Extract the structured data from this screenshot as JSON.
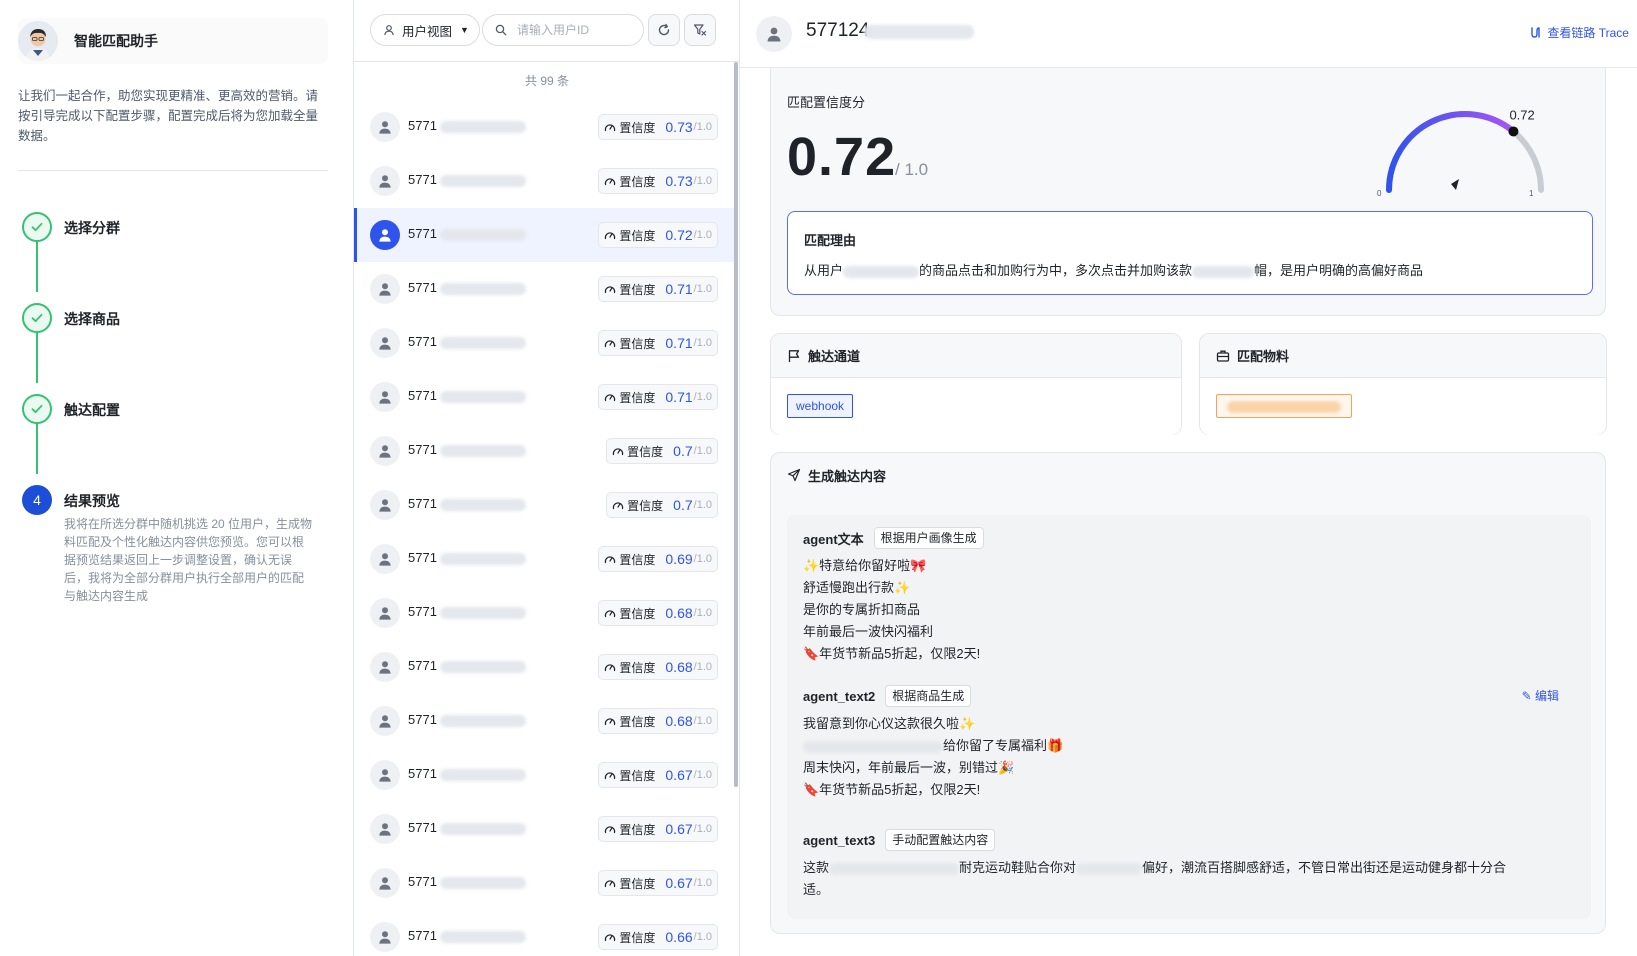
{
  "left": {
    "assistant_name": "智能匹配助手",
    "intro": "让我们一起合作，助您实现更精准、更高效的营销。请按引导完成以下配置步骤，配置完成后将为您加载全量数据。",
    "steps": [
      {
        "label": "选择分群",
        "status": "done"
      },
      {
        "label": "选择商品",
        "status": "done"
      },
      {
        "label": "触达配置",
        "status": "done"
      },
      {
        "label": "结果预览",
        "status": "active",
        "number": "4",
        "desc": "我将在所选分群中随机挑选 20 位用户，生成物料匹配及个性化触达内容供您预览。您可以根据预览结果返回上一步调整设置，确认无误后，我将为全部分群用户执行全部用户的匹配与触达内容生成"
      }
    ]
  },
  "middle": {
    "view_select": "用户视图",
    "search_placeholder": "请输入用户ID",
    "total": "共 99 条",
    "score_label": "置信度",
    "score_max": "/1.0",
    "rows": [
      {
        "id": "5771",
        "score": "0.73"
      },
      {
        "id": "5771",
        "score": "0.73"
      },
      {
        "id": "5771",
        "score": "0.72",
        "selected": true
      },
      {
        "id": "5771",
        "score": "0.71"
      },
      {
        "id": "5771",
        "score": "0.71"
      },
      {
        "id": "5771",
        "score": "0.71"
      },
      {
        "id": "5771",
        "score": "0.7"
      },
      {
        "id": "5771",
        "score": "0.7"
      },
      {
        "id": "5771",
        "score": "0.69"
      },
      {
        "id": "5771",
        "score": "0.68"
      },
      {
        "id": "5771",
        "score": "0.68"
      },
      {
        "id": "5771",
        "score": "0.68"
      },
      {
        "id": "5771",
        "score": "0.67"
      },
      {
        "id": "5771",
        "score": "0.67"
      },
      {
        "id": "5771",
        "score": "0.67"
      },
      {
        "id": "5771",
        "score": "0.66"
      }
    ]
  },
  "detail": {
    "user_id": "577124",
    "trace_label": "查看链路 Trace",
    "confidence_title": "匹配置信度分",
    "confidence_value": "0.72",
    "confidence_max": "/ 1.0",
    "gauge": {
      "value": 0.72,
      "label": "0.72",
      "min_label": "0",
      "max_label": "1"
    },
    "reason_title": "匹配理由",
    "reason_text_1": "从用户",
    "reason_text_2": "的商品点击和加购行为中，多次点击并加购该款",
    "reason_text_3": "帽，是用户明确的高偏好商品",
    "channel_title": "触达通道",
    "channel_tag": "webhook",
    "material_title": "匹配物料",
    "generate_title": "生成触达内容",
    "agents": [
      {
        "name": "agent文本",
        "tag": "根据用户画像生成",
        "lines": [
          "✨特意给你留好啦🎀",
          "舒适慢跑出行款✨",
          "是你的专属折扣商品",
          "年前最后一波快闪福利",
          "🔖年货节新品5折起，仅限2天!"
        ]
      },
      {
        "name": "agent_text2",
        "tag": "根据商品生成",
        "edit": "编辑",
        "lines": [
          "我留意到你心仪这款很久啦✨",
          "给你留了专属福利🎁",
          "周末快闪，年前最后一波，别错过🎉",
          "🔖年货节新品5折起，仅限2天!"
        ]
      },
      {
        "name": "agent_text3",
        "tag": "手动配置触达内容",
        "lines": [
          "这款",
          "耐克运动鞋贴合你对",
          "偏好，潮流百搭脚感舒适，不管日常出街还是运动健身都十分合",
          "适。"
        ]
      }
    ]
  },
  "colors": {
    "accent": "#2f54eb",
    "success": "#36c172",
    "material_border": "#f7a353",
    "reason_border": "#5b6cf9"
  }
}
